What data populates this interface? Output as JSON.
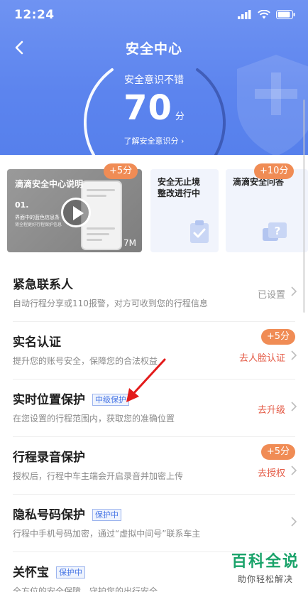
{
  "status_bar": {
    "time": "12:24"
  },
  "nav": {
    "title": "安全中心"
  },
  "score": {
    "label": "安全意识不错",
    "value": "70",
    "unit": "分",
    "link": "了解安全意识分 ›"
  },
  "cards": {
    "video": {
      "title": "滴滴安全中心说明",
      "number": "01.",
      "subtitle": "界面中的蓝色信息条",
      "subtitle2": "肾全程更好行程保护信息",
      "size": "7M",
      "badge": "+5分"
    },
    "card2": {
      "title_line1": "安全无止境",
      "title_line2": "整改进行中"
    },
    "card3": {
      "title": "滴滴安全问答",
      "badge": "+10分"
    }
  },
  "list": [
    {
      "title": "紧急联系人",
      "tag": "",
      "desc": "自动行程分享或110报警，对方可收到您的行程信息",
      "action": "已设置",
      "badge": ""
    },
    {
      "title": "实名认证",
      "tag": "",
      "desc": "提升您的账号安全，保障您的合法权益",
      "action": "去人脸认证",
      "badge": "+5分"
    },
    {
      "title": "实时位置保护",
      "tag": "中级保护",
      "desc": "在您设置的行程范围内，获取您的准确位置",
      "action": "去升级",
      "badge": ""
    },
    {
      "title": "行程录音保护",
      "tag": "",
      "desc": "授权后，行程中车主端会开启录音并加密上传",
      "action": "去授权",
      "badge": "+5分"
    },
    {
      "title": "隐私号码保护",
      "tag": "保护中",
      "desc": "行程中手机号码加密，通过“虚拟中间号”联系车主",
      "action": "",
      "badge": ""
    },
    {
      "title": "关怀宝",
      "tag": "保护中",
      "desc": "全方位的安全保障，守护您的出行安全",
      "action": "",
      "badge": ""
    }
  ],
  "watermark": {
    "main": "百科全说",
    "sub": "助你轻松解决"
  },
  "colors": {
    "header": "#5c84ee",
    "badge": "#f08c55",
    "action_red": "#e45a45",
    "tag_blue": "#4a78e6"
  }
}
